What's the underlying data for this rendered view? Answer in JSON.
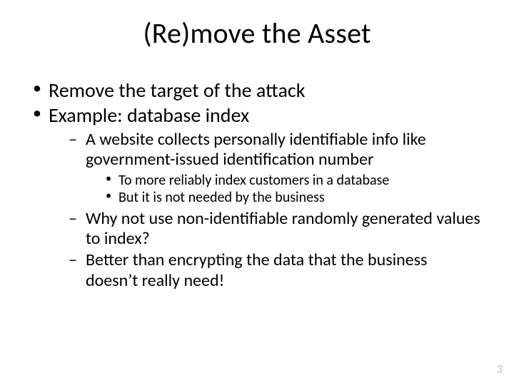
{
  "title": "(Re)move the Asset",
  "bullets": {
    "b1": "Remove the target of the attack",
    "b2": "Example: database index",
    "b2_1": "A website collects personally identifiable info like government-issued identification number",
    "b2_1_1": "To more reliably index customers in a database",
    "b2_1_2": "But it is not needed by the business",
    "b2_2": "Why not use non-identifiable randomly generated values to index?",
    "b2_3": "Better than encrypting the data that the business doesn’t really need!"
  },
  "page_number": "3"
}
